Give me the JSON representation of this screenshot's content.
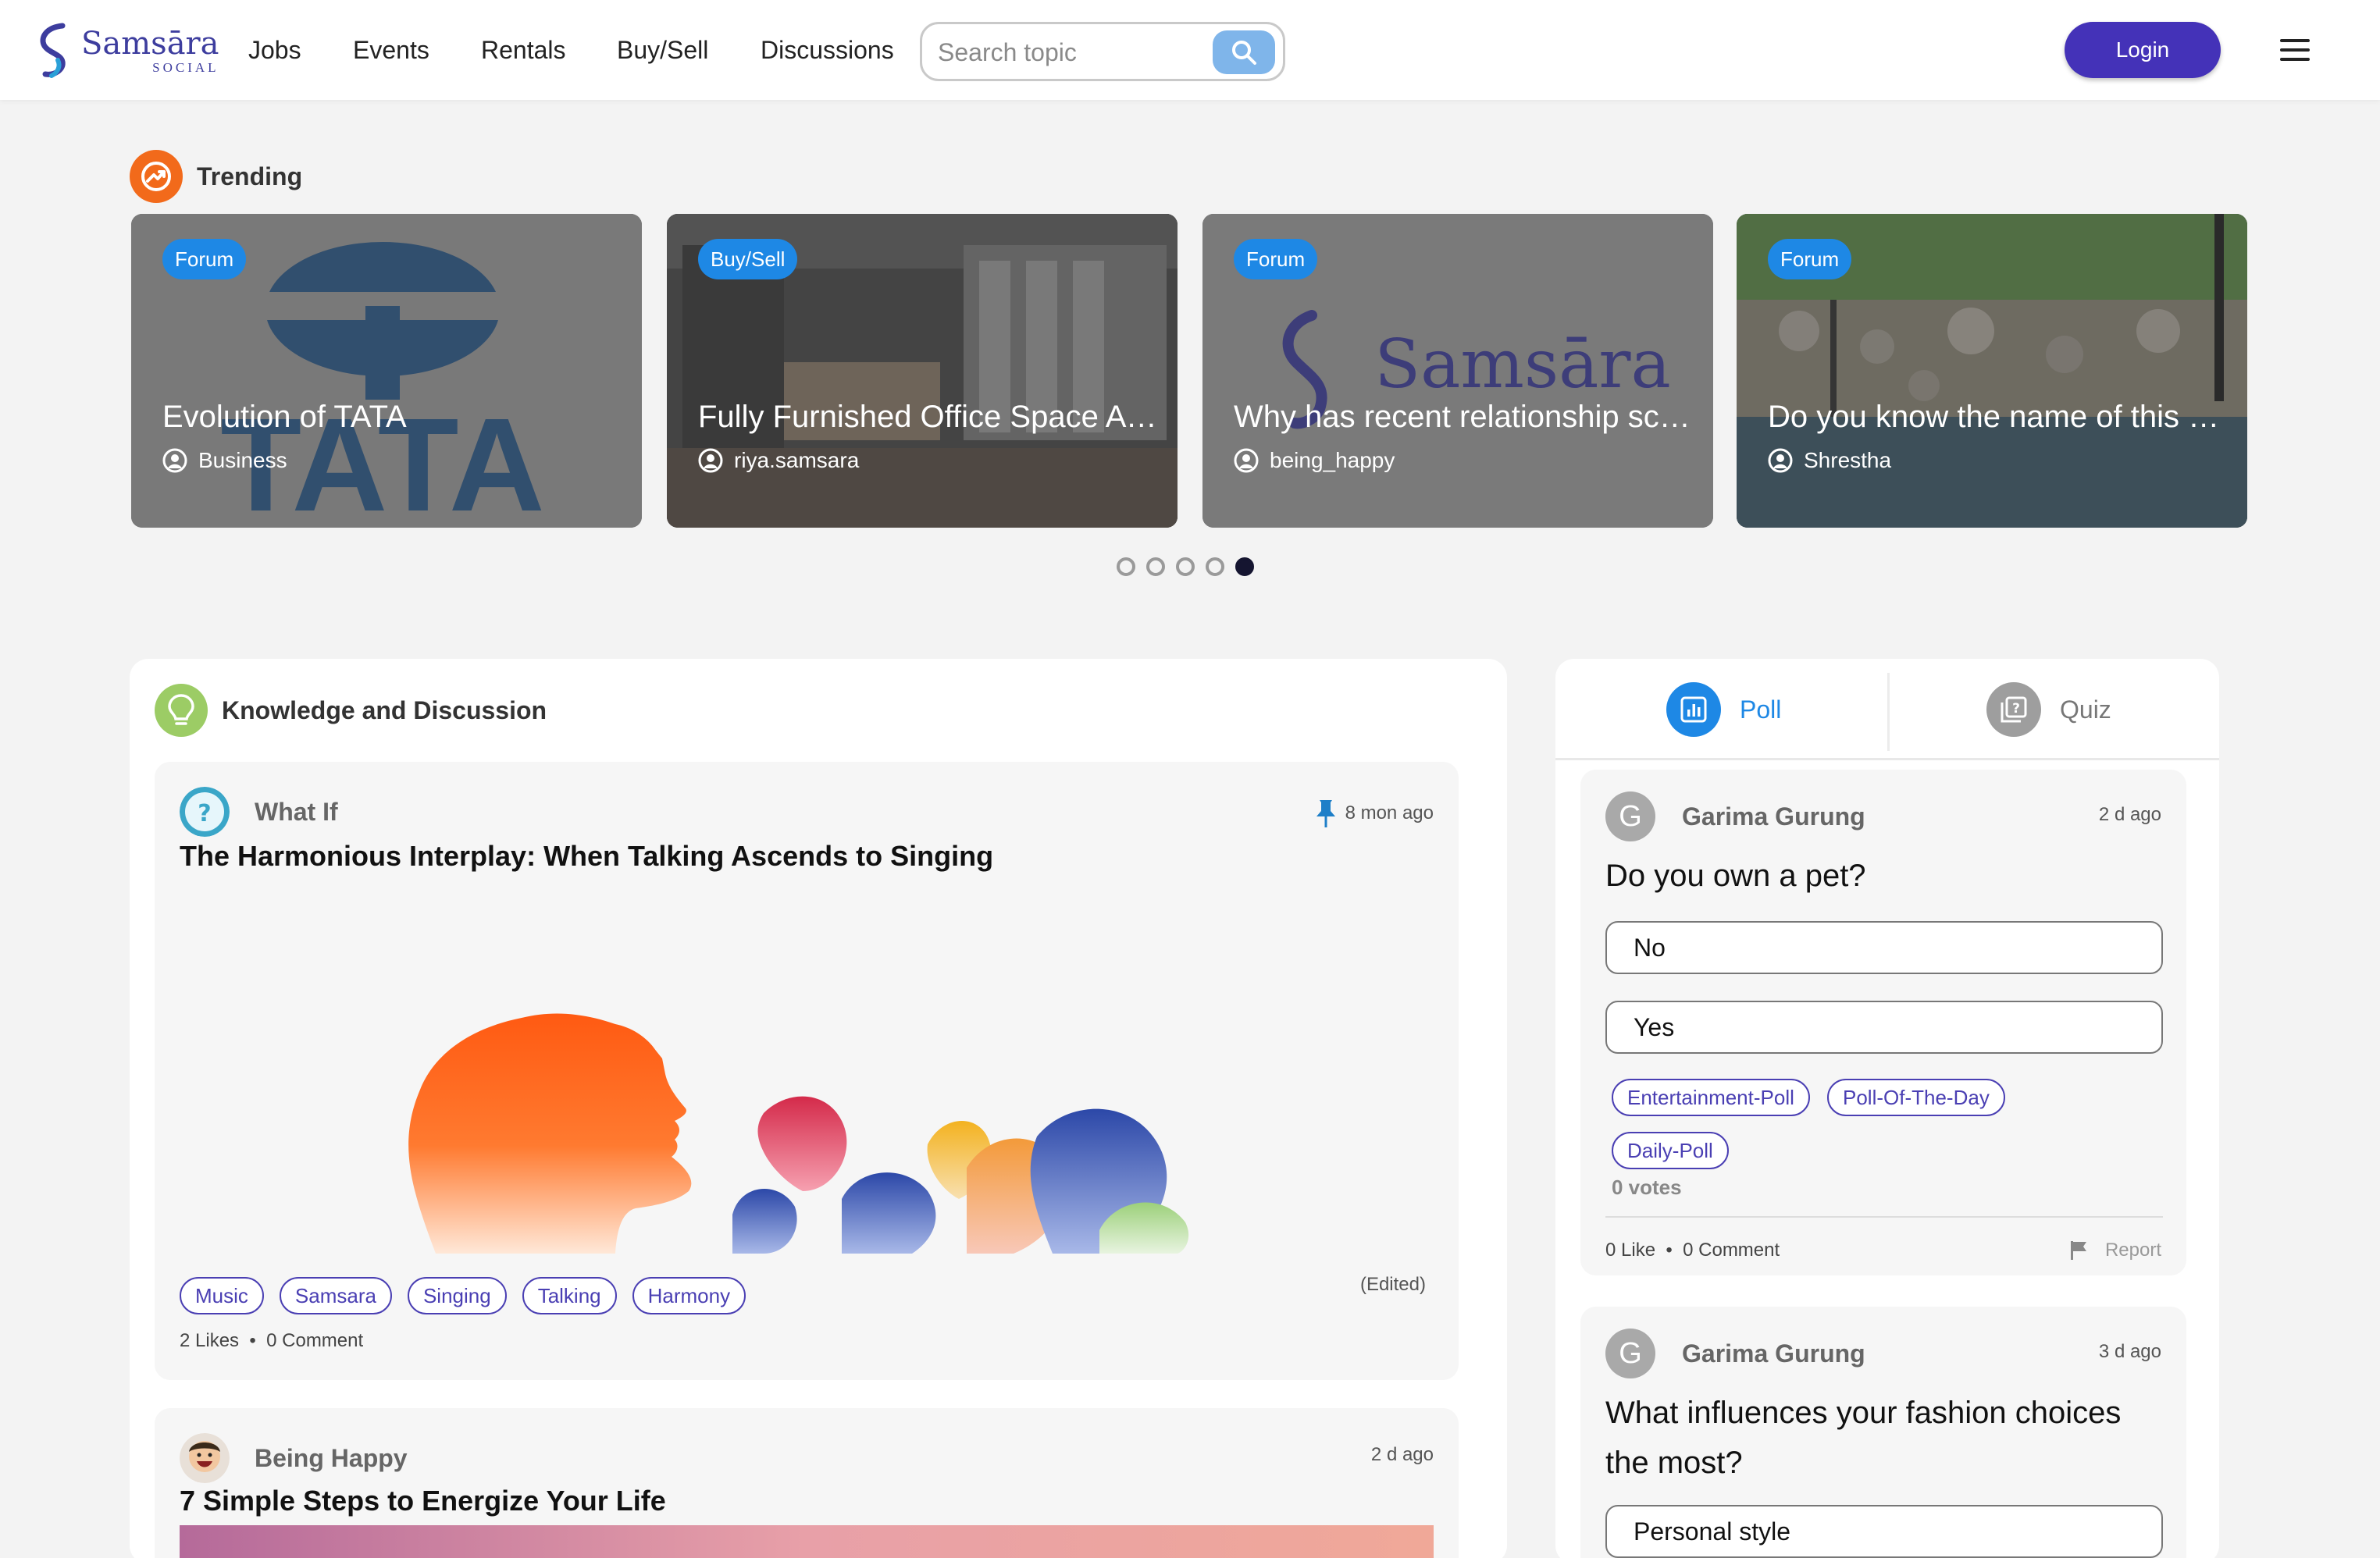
{
  "nav": {
    "logo_name": "Samsāra",
    "logo_sub": "SOCIAL",
    "links": [
      "Jobs",
      "Events",
      "Rentals",
      "Buy/Sell",
      "Discussions"
    ],
    "search_placeholder": "Search topic",
    "login_label": "Login",
    "icons": {
      "search": "search-icon",
      "menu": "hamburger-menu-icon"
    }
  },
  "trending": {
    "title": "Trending",
    "cards": [
      {
        "badge": "Forum",
        "title": "Evolution of TATA",
        "author": "Business"
      },
      {
        "badge": "Buy/Sell",
        "title": "Fully Furnished Office Space Available",
        "author": "riya.samsara"
      },
      {
        "badge": "Forum",
        "title": "Why has recent relationship scenario changed?",
        "author": "being_happy"
      },
      {
        "badge": "Forum",
        "title": "Do you know the name of this place?",
        "author": "Shrestha"
      }
    ],
    "card_image_text": {
      "tata": "TATA",
      "samsara": "Samsāra"
    },
    "carousel": {
      "pages": 5,
      "active": 5
    }
  },
  "knowledge": {
    "title": "Knowledge and Discussion",
    "posts": [
      {
        "category": "What If",
        "time": "8 mon ago",
        "pinned": true,
        "title": "The Harmonious Interplay: When Talking Ascends to Singing",
        "tags": [
          "Music",
          "Samsara",
          "Singing",
          "Talking",
          "Harmony"
        ],
        "edited": "(Edited)",
        "stats": "2 Likes  •  0 Comment"
      },
      {
        "category": "Being Happy",
        "time": "2 d ago",
        "title": "7 Simple Steps to Energize Your Life"
      }
    ]
  },
  "poll": {
    "tabs": [
      {
        "label": "Poll",
        "active": true
      },
      {
        "label": "Quiz",
        "active": false
      }
    ],
    "cards": [
      {
        "avatar": "G",
        "name": "Garima Gurung",
        "time": "2 d ago",
        "question": "Do you own a pet?",
        "options": [
          "No",
          "Yes"
        ],
        "tags": [
          "Entertainment-Poll",
          "Poll-Of-The-Day",
          "Daily-Poll"
        ],
        "votes": "0 votes",
        "stats": "0 Like  •  0 Comment",
        "report": "Report"
      },
      {
        "avatar": "G",
        "name": "Garima Gurung",
        "time": "3 d ago",
        "question": "What influences your fashion choices the most?",
        "options": [
          "Personal style"
        ]
      }
    ]
  },
  "colors": {
    "accent": "#4432b8",
    "badge": "#1e88e5",
    "trending_icon": "#f26a1b",
    "knowledge_icon": "#9ccc65",
    "poll_tab_active": "#1e88e5"
  }
}
